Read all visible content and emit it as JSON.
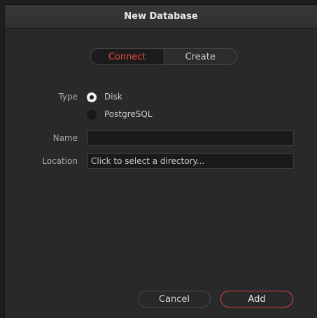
{
  "dialog": {
    "title": "New Database"
  },
  "mode_tabs": [
    {
      "label": "Connect",
      "active": true
    },
    {
      "label": "Create",
      "active": false
    }
  ],
  "form": {
    "type_label": "Type",
    "type_options": [
      {
        "label": "Disk",
        "selected": true
      },
      {
        "label": "PostgreSQL",
        "selected": false
      }
    ],
    "name_label": "Name",
    "name_value": "",
    "location_label": "Location",
    "location_placeholder": "Click to select a directory..."
  },
  "buttons": {
    "cancel": "Cancel",
    "add": "Add"
  },
  "colors": {
    "accent": "#e84a3c",
    "background": "#29292b"
  }
}
